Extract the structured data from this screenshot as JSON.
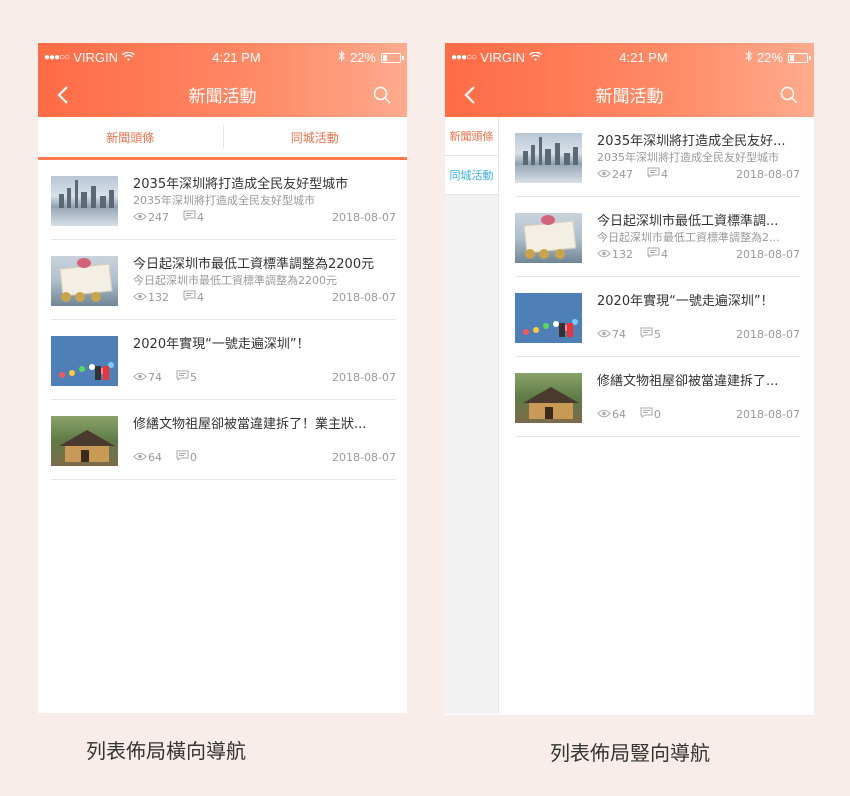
{
  "statusbar": {
    "carrier": "VIRGIN",
    "time": "4:21 PM",
    "battery": "22%"
  },
  "navbar": {
    "title": "新聞活動"
  },
  "phone1": {
    "tabs": [
      {
        "label": "新聞頭條"
      },
      {
        "label": "同城活動"
      }
    ],
    "items": [
      {
        "title": "2035年深圳將打造成全民友好型城市",
        "subtitle": "2035年深圳將打造成全民友好型城市",
        "views": "247",
        "comments": "4",
        "date": "2018-08-07",
        "thumb": "city-skyline"
      },
      {
        "title": "今日起深圳市最低工資標準調整為2200元",
        "subtitle": "今日起深圳市最低工資標準調整為2200元",
        "views": "132",
        "comments": "4",
        "date": "2018-08-07",
        "thumb": "money"
      },
      {
        "title": "2020年實現“一號走遍深圳”！",
        "subtitle": "",
        "views": "74",
        "comments": "5",
        "date": "2018-08-07",
        "thumb": "app-icons"
      },
      {
        "title": "修繕文物祖屋卻被當違建拆了！業主狀...",
        "subtitle": "",
        "views": "64",
        "comments": "0",
        "date": "2018-08-07",
        "thumb": "old-house"
      }
    ]
  },
  "phone2": {
    "tabs": [
      {
        "label": "新聞頭條"
      },
      {
        "label": "同城活動"
      }
    ],
    "items": [
      {
        "title": "2035年深圳將打造成全民友好...",
        "subtitle": "2035年深圳將打造成全民友好型城市",
        "views": "247",
        "comments": "4",
        "date": "2018-08-07",
        "thumb": "city-skyline"
      },
      {
        "title": "今日起深圳市最低工資標準調...",
        "subtitle": "今日起深圳市最低工資標準調整為2...",
        "views": "132",
        "comments": "4",
        "date": "2018-08-07",
        "thumb": "money"
      },
      {
        "title": "2020年實現“一號走遍深圳”！",
        "subtitle": "",
        "views": "74",
        "comments": "5",
        "date": "2018-08-07",
        "thumb": "app-icons"
      },
      {
        "title": "修繕文物祖屋卻被當違建拆了...",
        "subtitle": "",
        "views": "64",
        "comments": "0",
        "date": "2018-08-07",
        "thumb": "old-house"
      }
    ]
  },
  "captions": {
    "left": "列表佈局橫向導航",
    "right": "列表佈局豎向導航"
  },
  "colors": {
    "accent": "#ff7a50",
    "header_start": "#ff6b45",
    "header_end": "#ffab8e",
    "secondary_tab": "#3aaee0",
    "background": "#f8ede8"
  }
}
